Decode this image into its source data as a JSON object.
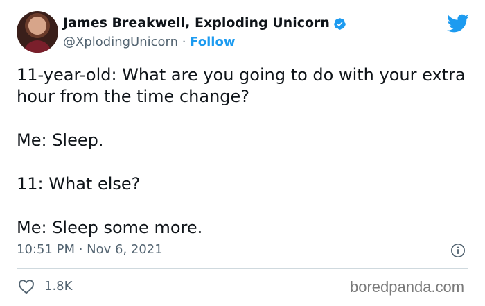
{
  "tweet": {
    "author_name": "James Breakwell, Exploding Unicorn",
    "handle": "@XplodingUnicorn",
    "separator": " · ",
    "follow_label": "Follow",
    "lines": [
      "11-year-old: What are you going to do with your extra hour from the time change?",
      "Me: Sleep.",
      "11: What else?",
      "Me: Sleep some more."
    ],
    "timestamp": "10:51 PM · Nov 6, 2021",
    "like_count": "1.8K"
  },
  "watermark": "boredpanda.com",
  "colors": {
    "accent": "#1d9bf0",
    "text": "#0f1419",
    "secondary": "#536471",
    "divider": "#cfd9de"
  },
  "icons": {
    "verified": "verified-badge-icon",
    "logo": "twitter-bird-icon",
    "info": "info-icon",
    "like": "heart-icon"
  }
}
